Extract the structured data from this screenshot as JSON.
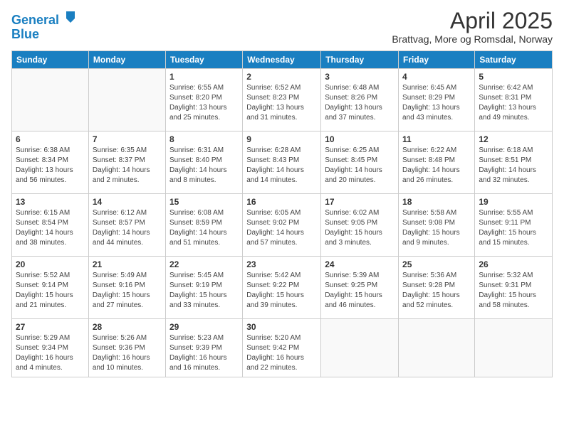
{
  "header": {
    "logo_line1": "General",
    "logo_line2": "Blue",
    "title": "April 2025",
    "subtitle": "Brattvag, More og Romsdal, Norway"
  },
  "weekdays": [
    "Sunday",
    "Monday",
    "Tuesday",
    "Wednesday",
    "Thursday",
    "Friday",
    "Saturday"
  ],
  "weeks": [
    [
      {
        "day": "",
        "info": ""
      },
      {
        "day": "",
        "info": ""
      },
      {
        "day": "1",
        "info": "Sunrise: 6:55 AM\nSunset: 8:20 PM\nDaylight: 13 hours\nand 25 minutes."
      },
      {
        "day": "2",
        "info": "Sunrise: 6:52 AM\nSunset: 8:23 PM\nDaylight: 13 hours\nand 31 minutes."
      },
      {
        "day": "3",
        "info": "Sunrise: 6:48 AM\nSunset: 8:26 PM\nDaylight: 13 hours\nand 37 minutes."
      },
      {
        "day": "4",
        "info": "Sunrise: 6:45 AM\nSunset: 8:29 PM\nDaylight: 13 hours\nand 43 minutes."
      },
      {
        "day": "5",
        "info": "Sunrise: 6:42 AM\nSunset: 8:31 PM\nDaylight: 13 hours\nand 49 minutes."
      }
    ],
    [
      {
        "day": "6",
        "info": "Sunrise: 6:38 AM\nSunset: 8:34 PM\nDaylight: 13 hours\nand 56 minutes."
      },
      {
        "day": "7",
        "info": "Sunrise: 6:35 AM\nSunset: 8:37 PM\nDaylight: 14 hours\nand 2 minutes."
      },
      {
        "day": "8",
        "info": "Sunrise: 6:31 AM\nSunset: 8:40 PM\nDaylight: 14 hours\nand 8 minutes."
      },
      {
        "day": "9",
        "info": "Sunrise: 6:28 AM\nSunset: 8:43 PM\nDaylight: 14 hours\nand 14 minutes."
      },
      {
        "day": "10",
        "info": "Sunrise: 6:25 AM\nSunset: 8:45 PM\nDaylight: 14 hours\nand 20 minutes."
      },
      {
        "day": "11",
        "info": "Sunrise: 6:22 AM\nSunset: 8:48 PM\nDaylight: 14 hours\nand 26 minutes."
      },
      {
        "day": "12",
        "info": "Sunrise: 6:18 AM\nSunset: 8:51 PM\nDaylight: 14 hours\nand 32 minutes."
      }
    ],
    [
      {
        "day": "13",
        "info": "Sunrise: 6:15 AM\nSunset: 8:54 PM\nDaylight: 14 hours\nand 38 minutes."
      },
      {
        "day": "14",
        "info": "Sunrise: 6:12 AM\nSunset: 8:57 PM\nDaylight: 14 hours\nand 44 minutes."
      },
      {
        "day": "15",
        "info": "Sunrise: 6:08 AM\nSunset: 8:59 PM\nDaylight: 14 hours\nand 51 minutes."
      },
      {
        "day": "16",
        "info": "Sunrise: 6:05 AM\nSunset: 9:02 PM\nDaylight: 14 hours\nand 57 minutes."
      },
      {
        "day": "17",
        "info": "Sunrise: 6:02 AM\nSunset: 9:05 PM\nDaylight: 15 hours\nand 3 minutes."
      },
      {
        "day": "18",
        "info": "Sunrise: 5:58 AM\nSunset: 9:08 PM\nDaylight: 15 hours\nand 9 minutes."
      },
      {
        "day": "19",
        "info": "Sunrise: 5:55 AM\nSunset: 9:11 PM\nDaylight: 15 hours\nand 15 minutes."
      }
    ],
    [
      {
        "day": "20",
        "info": "Sunrise: 5:52 AM\nSunset: 9:14 PM\nDaylight: 15 hours\nand 21 minutes."
      },
      {
        "day": "21",
        "info": "Sunrise: 5:49 AM\nSunset: 9:16 PM\nDaylight: 15 hours\nand 27 minutes."
      },
      {
        "day": "22",
        "info": "Sunrise: 5:45 AM\nSunset: 9:19 PM\nDaylight: 15 hours\nand 33 minutes."
      },
      {
        "day": "23",
        "info": "Sunrise: 5:42 AM\nSunset: 9:22 PM\nDaylight: 15 hours\nand 39 minutes."
      },
      {
        "day": "24",
        "info": "Sunrise: 5:39 AM\nSunset: 9:25 PM\nDaylight: 15 hours\nand 46 minutes."
      },
      {
        "day": "25",
        "info": "Sunrise: 5:36 AM\nSunset: 9:28 PM\nDaylight: 15 hours\nand 52 minutes."
      },
      {
        "day": "26",
        "info": "Sunrise: 5:32 AM\nSunset: 9:31 PM\nDaylight: 15 hours\nand 58 minutes."
      }
    ],
    [
      {
        "day": "27",
        "info": "Sunrise: 5:29 AM\nSunset: 9:34 PM\nDaylight: 16 hours\nand 4 minutes."
      },
      {
        "day": "28",
        "info": "Sunrise: 5:26 AM\nSunset: 9:36 PM\nDaylight: 16 hours\nand 10 minutes."
      },
      {
        "day": "29",
        "info": "Sunrise: 5:23 AM\nSunset: 9:39 PM\nDaylight: 16 hours\nand 16 minutes."
      },
      {
        "day": "30",
        "info": "Sunrise: 5:20 AM\nSunset: 9:42 PM\nDaylight: 16 hours\nand 22 minutes."
      },
      {
        "day": "",
        "info": ""
      },
      {
        "day": "",
        "info": ""
      },
      {
        "day": "",
        "info": ""
      }
    ]
  ]
}
